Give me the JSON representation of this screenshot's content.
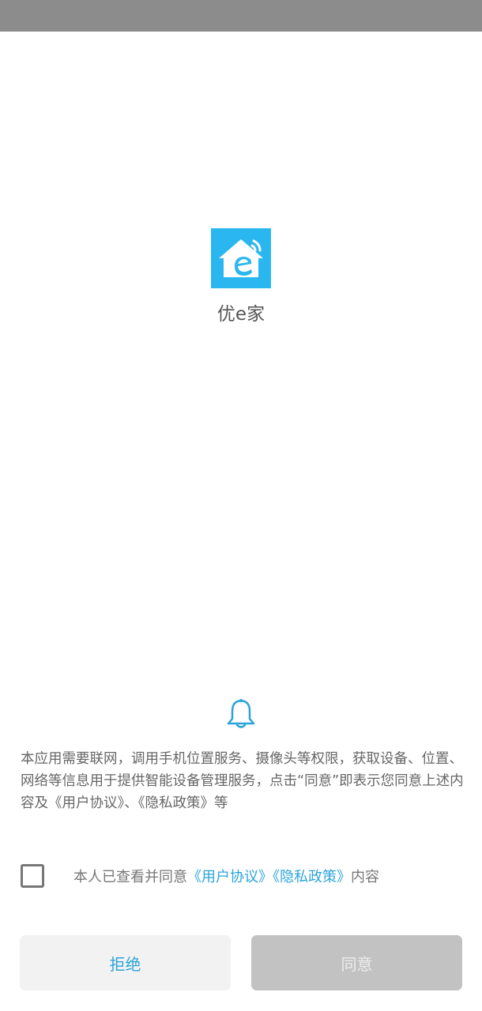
{
  "app": {
    "name": "优e家",
    "icon": "app-house-e-icon",
    "brand_color": "#2ab7ef"
  },
  "notice": {
    "icon": "bell-icon",
    "text": "本应用需要联网，调用手机位置服务、摄像头等权限，获取设备、位置、网络等信息用于提供智能设备管理服务，点击“同意”即表示您同意上述内容及《用户协议》、《隐私政策》等"
  },
  "consent": {
    "checked": false,
    "prefix": "本人已查看并同意",
    "user_agreement": "《用户协议》",
    "privacy_policy": "《隐私政策》",
    "suffix": "内容",
    "link_color": "#2ca4d9"
  },
  "buttons": {
    "reject": "拒绝",
    "agree": "同意"
  }
}
